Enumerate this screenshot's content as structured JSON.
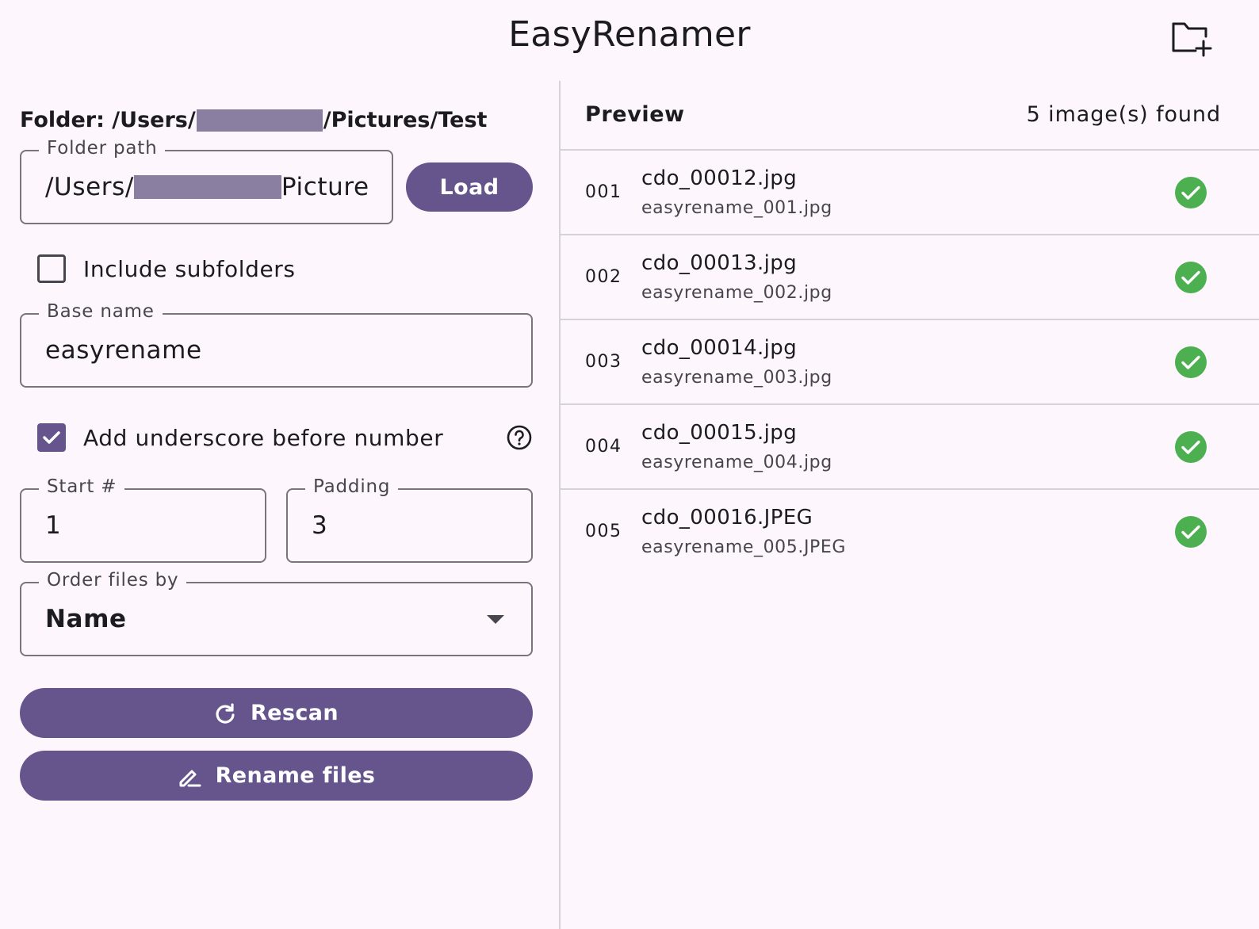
{
  "app": {
    "title": "EasyRenamer"
  },
  "toolbar": {
    "open_folder_icon": "folder-add-icon"
  },
  "left": {
    "folder_prefix": "Folder: /Users/",
    "folder_suffix": "/Pictures/Test",
    "folder_path": {
      "label": "Folder path",
      "value_prefix": "/Users/",
      "value_suffix": "Picture"
    },
    "load_label": "Load",
    "include_subfolders": {
      "label": "Include subfolders",
      "checked": false
    },
    "base_name": {
      "label": "Base name",
      "value": "easyrename"
    },
    "underscore": {
      "label": "Add underscore before number",
      "checked": true
    },
    "start": {
      "label": "Start #",
      "value": "1"
    },
    "padding": {
      "label": "Padding",
      "value": "3"
    },
    "order": {
      "label": "Order files by",
      "value": "Name"
    },
    "rescan_label": "Rescan",
    "rename_label": "Rename files"
  },
  "preview": {
    "title": "Preview",
    "count": "5 image(s) found",
    "rows": [
      {
        "idx": "001",
        "old": "cdo_00012.jpg",
        "new": "easyrename_001.jpg",
        "status": "ok"
      },
      {
        "idx": "002",
        "old": "cdo_00013.jpg",
        "new": "easyrename_002.jpg",
        "status": "ok"
      },
      {
        "idx": "003",
        "old": "cdo_00014.jpg",
        "new": "easyrename_003.jpg",
        "status": "ok"
      },
      {
        "idx": "004",
        "old": "cdo_00015.jpg",
        "new": "easyrename_004.jpg",
        "status": "ok"
      },
      {
        "idx": "005",
        "old": "cdo_00016.JPEG",
        "new": "easyrename_005.JPEG",
        "status": "ok"
      }
    ]
  },
  "colors": {
    "primary": "#66558c",
    "success": "#4caf50",
    "background": "#fdf7fd",
    "outline": "#79747e"
  }
}
